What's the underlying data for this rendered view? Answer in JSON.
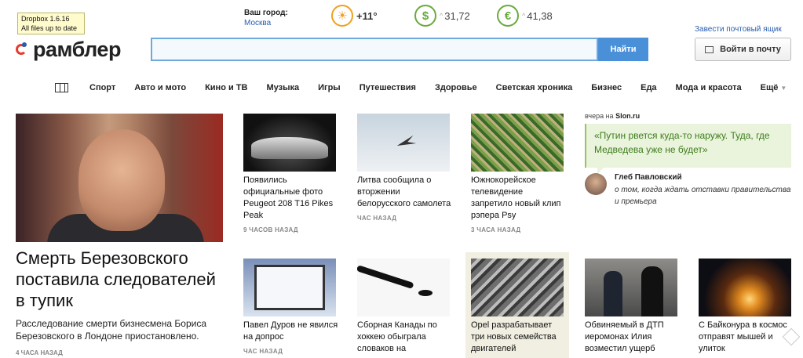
{
  "tooltip": {
    "line1": "Dropbox 1.6.16",
    "line2": "All files up to date"
  },
  "logo": {
    "text": "рамблер"
  },
  "city": {
    "label": "Ваш город:",
    "name": "Москва"
  },
  "weather": {
    "icon": "sun-icon",
    "temp": "+11°"
  },
  "currency": [
    {
      "icon": "dollar-icon",
      "symbol": "$",
      "value": "31,72"
    },
    {
      "icon": "euro-icon",
      "symbol": "€",
      "value": "41,38"
    }
  ],
  "search": {
    "value": "",
    "placeholder": "",
    "button": "Найти"
  },
  "account": {
    "create_mail": "Завести почтовый ящик",
    "login": "Войти в почту"
  },
  "nav": {
    "items": [
      "Спорт",
      "Авто и мото",
      "Кино и ТВ",
      "Музыка",
      "Игры",
      "Путешествия",
      "Здоровье",
      "Светская хроника",
      "Бизнес",
      "Еда",
      "Мода и красота"
    ],
    "more": "Ещё"
  },
  "main_story": {
    "title": "Смерть Березовского поставила следователей в тупик",
    "desc": "Расследование смерти бизнесмена Бориса Березовского в Лондоне приостановлено.",
    "time": "4 ЧАСА НАЗАД"
  },
  "news": [
    {
      "title": "Появились официальные фото Peugeot 208 T16 Pikes Peak",
      "time": "9 ЧАСОВ НАЗАД"
    },
    {
      "title": "Литва сообщила о вторжении белорусского самолета",
      "time": "ЧАС НАЗАД"
    },
    {
      "title": "Южнокорейское телевидение запретило новый клип рэпера Psy",
      "time": "3 ЧАСА НАЗАД"
    },
    {
      "title": "Павел Дуров не явился на допрос",
      "time": "ЧАС НАЗАД"
    },
    {
      "title": "Сборная Канады по хоккею обыграла словаков на",
      "time": ""
    },
    {
      "title": "Opel разрабатывает три новых семейства двигателей",
      "time": ""
    },
    {
      "title": "Обвиняемый в ДТП иеромонах Илия возместил ущерб",
      "time": ""
    },
    {
      "title": "С Байконура в космос отправят мышей и улиток",
      "time": ""
    }
  ],
  "quote": {
    "source_prefix": "вчера на",
    "source": "Slon.ru",
    "text": "«Путин рвется куда-то наружу. Туда, где Медведева уже не будет»",
    "author": "Глеб Павловский",
    "desc": "о том, когда ждать отставки правительства и премьера"
  }
}
